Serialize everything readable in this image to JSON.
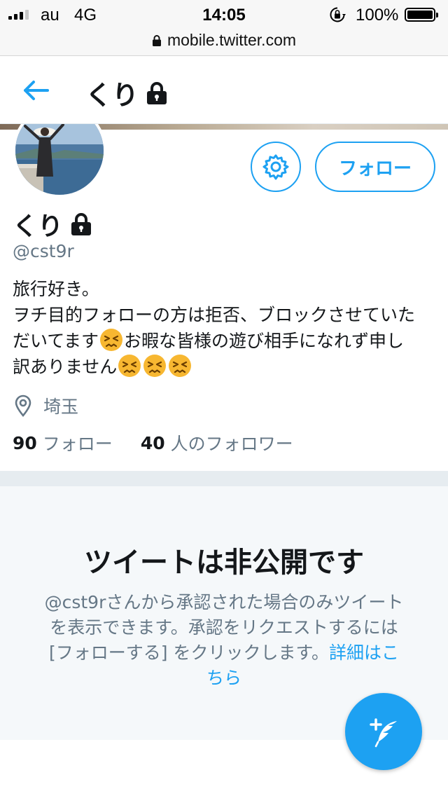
{
  "status_bar": {
    "carrier": "au",
    "network": "4G",
    "time": "14:05",
    "battery": "100%"
  },
  "browser": {
    "url": "mobile.twitter.com"
  },
  "header": {
    "title": "くり",
    "back_icon": "back-arrow-icon",
    "lock_icon": "lock-icon"
  },
  "profile": {
    "name": "くり",
    "handle": "@cst9r",
    "follow_label": "フォロー",
    "settings_icon": "gear-icon",
    "bio": {
      "line1": "旅行好き。",
      "line2": "ヲチ目的フォローの方は拒否、ブロックさせていた",
      "line3a": "だいてます",
      "line3b": "お暇な皆様の遊び相手になれず申し",
      "line4": "訳ありません"
    },
    "emoji": "persevering-face",
    "location": "埼玉",
    "following_count": "90",
    "following_label": "フォロー",
    "followers_count": "40",
    "followers_label": "人のフォロワー"
  },
  "protected": {
    "title": "ツイートは非公開です",
    "line1": "@cst9rさんから承認された場合のみツイート",
    "line2": "を表示できます。承認をリクエストするには",
    "line3": "[フォローする] をクリックします。",
    "link_part1": "詳細はこ",
    "link_part2": "ちら"
  },
  "compose": {
    "icon": "compose-tweet-icon"
  },
  "colors": {
    "accent": "#1da1f2",
    "secondary_text": "#657786",
    "protected_bg": "#f5f8fa"
  }
}
